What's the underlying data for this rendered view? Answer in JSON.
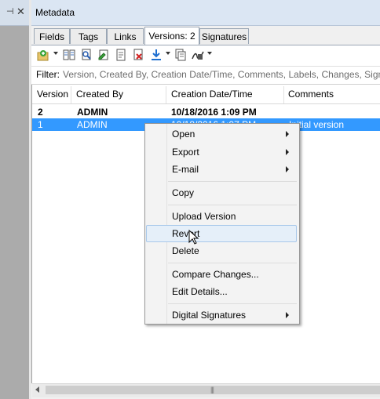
{
  "panel": {
    "title": "Metadata",
    "pin_glyph": "⊣",
    "close_glyph": "✕"
  },
  "tabs": [
    {
      "label": "Fields"
    },
    {
      "label": "Tags"
    },
    {
      "label": "Links"
    },
    {
      "label": "Versions: 2",
      "active": true
    },
    {
      "label": "Signatures"
    }
  ],
  "toolbar": {
    "icons": [
      "add-version-icon",
      "compare-icon",
      "view-details-icon",
      "edit-icon",
      "export-icon",
      "delete-icon",
      "download-icon",
      "copy-icon",
      "signature-icon"
    ]
  },
  "filter": {
    "label": "Filter:",
    "placeholder": "Version, Created By, Creation Date/Time, Comments, Labels, Changes, Signatures"
  },
  "grid": {
    "columns": [
      "Version",
      "Created By",
      "Creation Date/Time",
      "Comments"
    ],
    "rows": [
      {
        "version": "2",
        "created_by": "ADMIN",
        "date": "10/18/2016 1:09 PM",
        "comments": ""
      },
      {
        "version": "1",
        "created_by": "ADMIN",
        "date": "10/18/2016 1:07 PM",
        "comments": "Initial version"
      }
    ]
  },
  "scrollbar": {
    "grip": "|||"
  },
  "context_menu": {
    "items": [
      {
        "label": "Open",
        "submenu": true
      },
      {
        "label": "Export",
        "submenu": true
      },
      {
        "label": "E-mail",
        "submenu": true
      },
      {
        "label": "Copy"
      },
      {
        "label": "Upload Version"
      },
      {
        "label": "Revert",
        "hovered": true
      },
      {
        "label": "Delete"
      },
      {
        "label": "Compare Changes..."
      },
      {
        "label": "Edit Details..."
      },
      {
        "label": "Digital Signatures",
        "submenu": true
      }
    ]
  },
  "colors": {
    "selection": "#3399ff",
    "title_bar": "#dbe6f3",
    "menu_hover": "#e5eff9"
  }
}
